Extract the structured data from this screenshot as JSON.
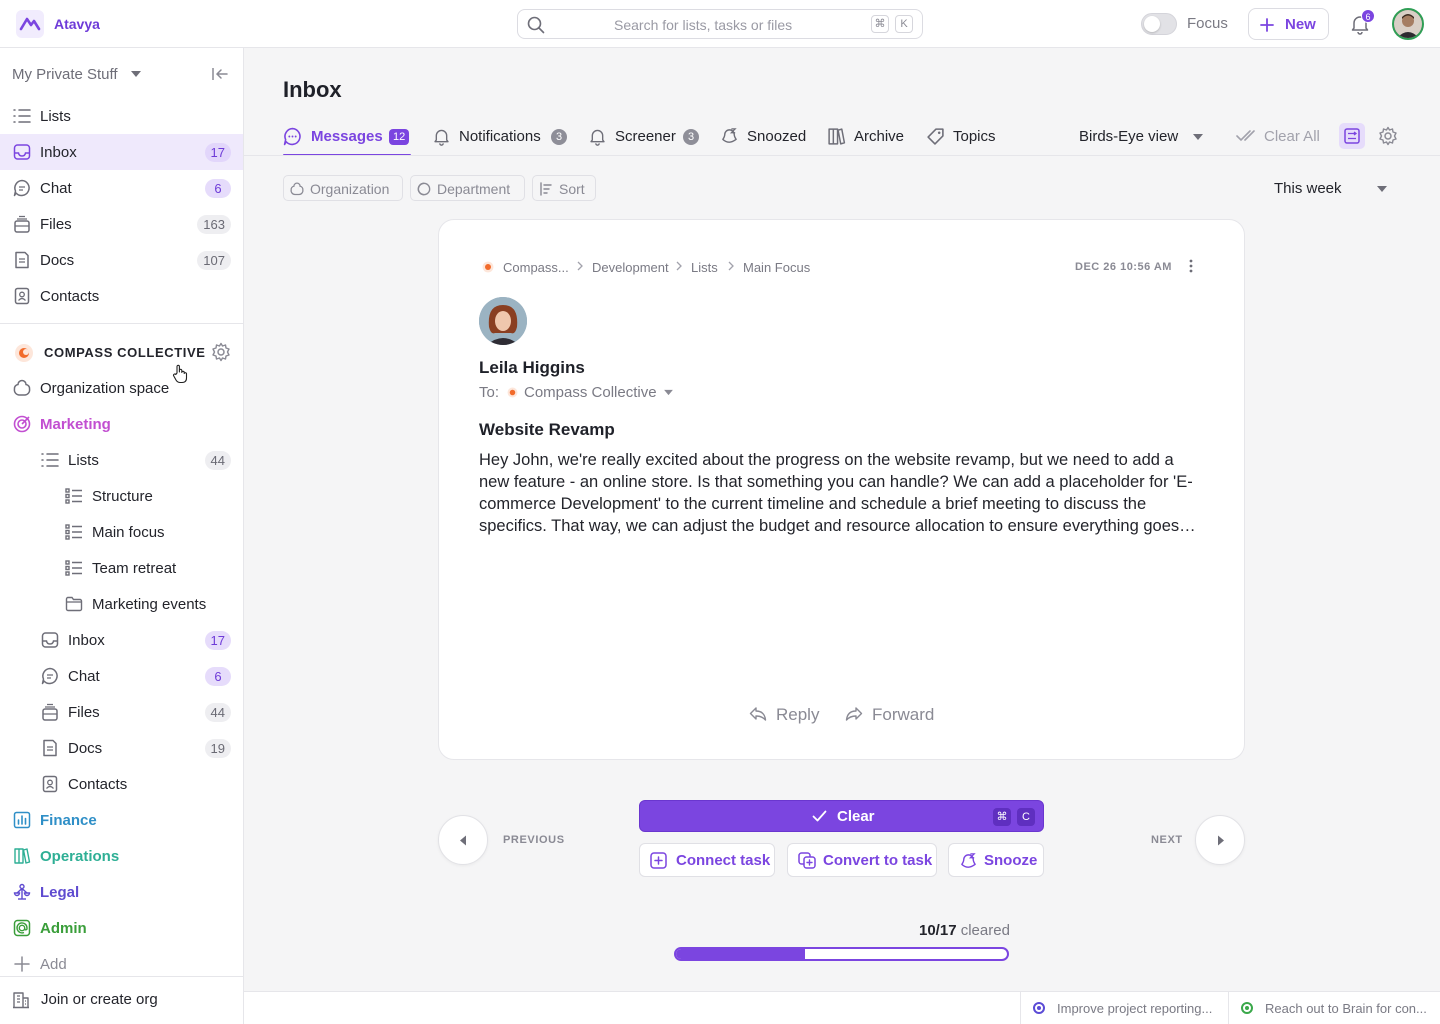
{
  "brand": {
    "name": "Atavya",
    "accent": "#7b45e0"
  },
  "search": {
    "placeholder": "Search for lists, tasks or files",
    "kbd1": "⌘",
    "kbd2": "K"
  },
  "topbar": {
    "focus_label": "Focus",
    "new_label": "New",
    "notification_count": "6"
  },
  "sidebar": {
    "workspace": "My Private Stuff",
    "personal": [
      {
        "label": "Lists",
        "icon": "list-icon"
      },
      {
        "label": "Inbox",
        "count": "17",
        "icon": "inbox-icon",
        "active": true
      },
      {
        "label": "Chat",
        "count": "6",
        "icon": "chat-icon"
      },
      {
        "label": "Files",
        "count": "163",
        "icon": "files-icon"
      },
      {
        "label": "Docs",
        "count": "107",
        "icon": "docs-icon"
      },
      {
        "label": "Contacts",
        "icon": "contacts-icon"
      }
    ],
    "org_name": "COMPASS COLLECTIVE",
    "org_space": "Organization space",
    "marketing": {
      "label": "Marketing",
      "color": "#c24fd1",
      "lists": {
        "label": "Lists",
        "count": "44"
      },
      "sublists": [
        "Structure",
        "Main focus",
        "Team retreat",
        "Marketing events"
      ],
      "items": [
        {
          "label": "Inbox",
          "count": "17"
        },
        {
          "label": "Chat",
          "count": "6"
        },
        {
          "label": "Files",
          "count": "44"
        },
        {
          "label": "Docs",
          "count": "19"
        },
        {
          "label": "Contacts"
        }
      ]
    },
    "spaces": [
      {
        "label": "Finance",
        "color": "#2f8fc7"
      },
      {
        "label": "Operations",
        "color": "#2eaf95"
      },
      {
        "label": "Legal",
        "color": "#5f4bd0"
      },
      {
        "label": "Admin",
        "color": "#3a9e3a"
      }
    ],
    "add_label": "Add",
    "join_label": "Join or create org"
  },
  "main": {
    "title": "Inbox",
    "tabs": [
      {
        "label": "Messages",
        "count": "12"
      },
      {
        "label": "Notifications",
        "count": "3"
      },
      {
        "label": "Screener",
        "count": "3"
      },
      {
        "label": "Snoozed"
      },
      {
        "label": "Archive"
      },
      {
        "label": "Topics"
      }
    ],
    "view_select": "Birds-Eye view",
    "clear_all": "Clear All",
    "filters": [
      "Organization",
      "Department",
      "Sort"
    ],
    "range_select": "This week"
  },
  "message": {
    "breadcrumb": [
      "Compass...",
      "Development",
      "Lists",
      "Main Focus"
    ],
    "date": "DEC 26 10:56 AM",
    "sender": "Leila Higgins",
    "to_label": "To:",
    "to_value": "Compass Collective",
    "subject": "Website Revamp",
    "body": "Hey John, we're really excited about the progress on the website revamp, but we need to add a new feature - an online store. Is that something you can handle? We can add a placeholder for 'E-commerce Development' to the current timeline and schedule a brief meeting to discuss the specifics. That way, we can adjust the budget and resource allocation to ensure everything goes smoothly.",
    "reply_label": "Reply",
    "forward_label": "Forward"
  },
  "actions": {
    "previous": "PREVIOUS",
    "next": "NEXT",
    "clear": "Clear",
    "clear_kbd1": "⌘",
    "clear_kbd2": "C",
    "connect": "Connect task",
    "convert": "Convert to task",
    "snooze": "Snooze"
  },
  "progress": {
    "done": "10/17",
    "label": "cleared",
    "fraction": 0.39
  },
  "bottom_tasks": [
    {
      "label": "Improve project reporting...",
      "color": "#5b4bd6"
    },
    {
      "label": "Reach out to Brain for con...",
      "color": "#3aa84a"
    }
  ]
}
